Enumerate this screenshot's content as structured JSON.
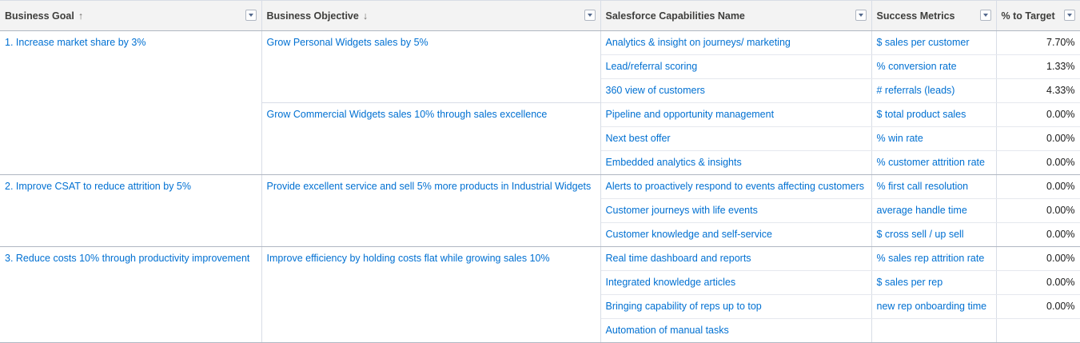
{
  "columns": [
    {
      "label": "Business Goal",
      "sort": "↑"
    },
    {
      "label": "Business Objective",
      "sort": "↓"
    },
    {
      "label": "Salesforce Capabilities Name",
      "sort": ""
    },
    {
      "label": "Success Metrics",
      "sort": ""
    },
    {
      "label": "% to Target",
      "sort": ""
    }
  ],
  "goals": [
    {
      "goal": "1. Increase market share by 3%",
      "objectives": [
        {
          "objective": "Grow Personal Widgets sales by 5%",
          "rows": [
            {
              "capability": "Analytics & insight on journeys/ marketing",
              "metric": "$ sales per customer",
              "percent": "7.70%"
            },
            {
              "capability": "Lead/referral scoring",
              "metric": "% conversion rate",
              "percent": "1.33%"
            },
            {
              "capability": "360 view of customers",
              "metric": "# referrals (leads)",
              "percent": "4.33%"
            }
          ]
        },
        {
          "objective": "Grow Commercial Widgets sales 10% through sales excellence",
          "rows": [
            {
              "capability": "Pipeline and opportunity management",
              "metric": "$ total product sales",
              "percent": "0.00%"
            },
            {
              "capability": "Next best offer",
              "metric": "% win rate",
              "percent": "0.00%"
            },
            {
              "capability": "Embedded analytics & insights",
              "metric": "% customer attrition rate",
              "percent": "0.00%"
            }
          ]
        }
      ]
    },
    {
      "goal": "2. Improve CSAT to reduce attrition by 5%",
      "objectives": [
        {
          "objective": "Provide excellent service and sell 5% more products in Industrial Widgets",
          "rows": [
            {
              "capability": "Alerts to proactively respond to events affecting customers",
              "metric": "% first call resolution",
              "percent": "0.00%"
            },
            {
              "capability": "Customer journeys with life events",
              "metric": "average handle time",
              "percent": "0.00%"
            },
            {
              "capability": "Customer knowledge and self-service",
              "metric": "$ cross sell / up sell",
              "percent": "0.00%"
            }
          ]
        }
      ]
    },
    {
      "goal": "3. Reduce costs 10% through productivity improvement",
      "objectives": [
        {
          "objective": "Improve efficiency by holding costs flat while growing sales 10%",
          "rows": [
            {
              "capability": "Real time dashboard and reports",
              "metric": "% sales rep attrition rate",
              "percent": "0.00%"
            },
            {
              "capability": "Integrated knowledge articles",
              "metric": "$ sales per rep",
              "percent": "0.00%"
            },
            {
              "capability": "Bringing capability of reps up to top",
              "metric": "new rep onboarding time",
              "percent": "0.00%"
            },
            {
              "capability": "Automation of manual tasks",
              "metric": "",
              "percent": ""
            }
          ]
        }
      ]
    }
  ]
}
